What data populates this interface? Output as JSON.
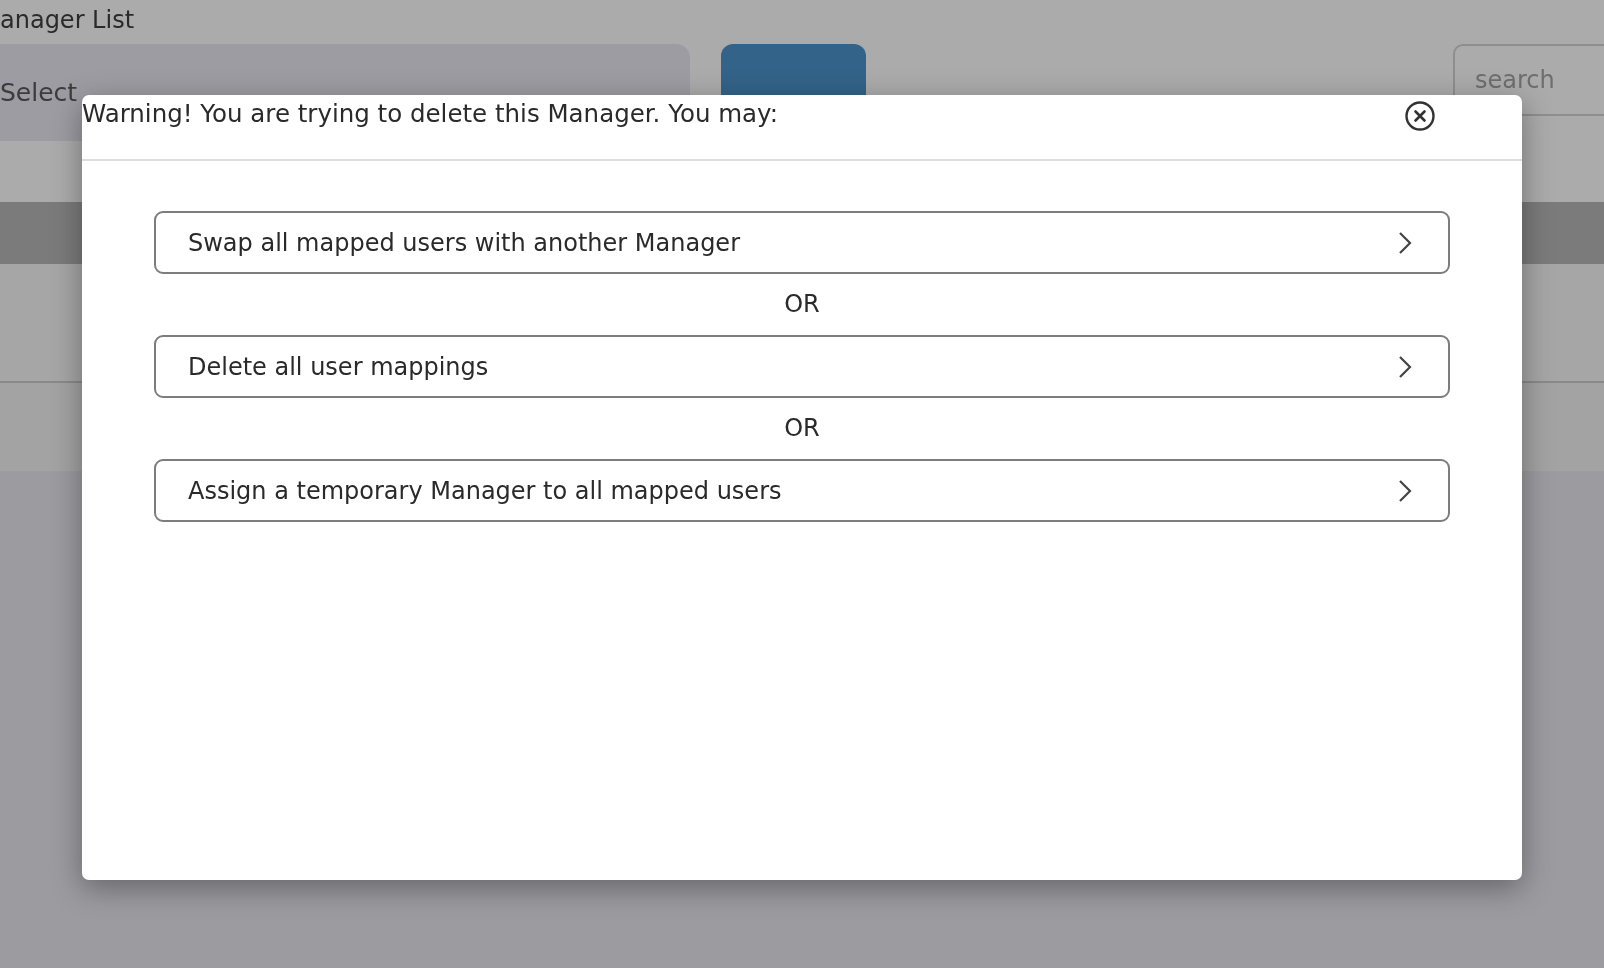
{
  "page": {
    "title": "anager List",
    "select": {
      "value": "Select"
    },
    "search": {
      "placeholder": "search"
    }
  },
  "modal": {
    "message": "Warning! You are trying to delete this Manager. You may:",
    "options": [
      {
        "label": "Swap all mapped users with another Manager"
      },
      {
        "label": "Delete all user mappings"
      },
      {
        "label": "Assign a temporary Manager to all mapped users"
      }
    ],
    "separators": [
      "OR",
      "OR"
    ]
  }
}
